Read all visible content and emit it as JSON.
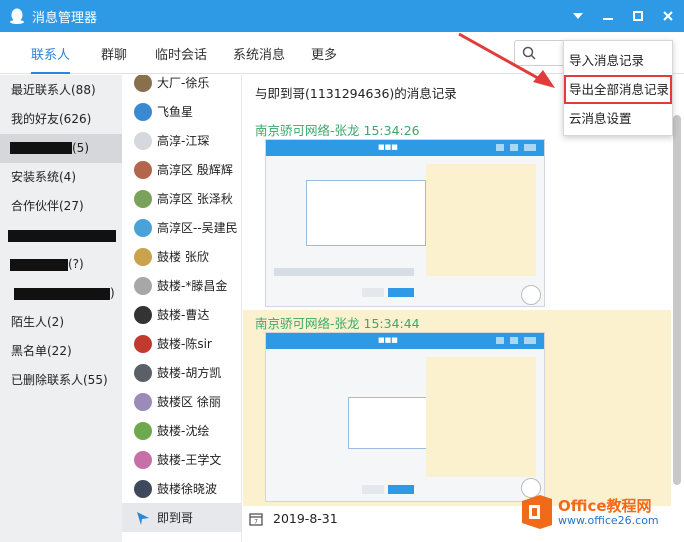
{
  "window": {
    "title": "消息管理器",
    "controls": [
      "chevron-down",
      "minimize",
      "maximize",
      "close"
    ]
  },
  "nav": {
    "tabs": [
      "联系人",
      "群聊",
      "临时会话",
      "系统消息",
      "更多"
    ],
    "active_tab": "联系人",
    "search_placeholder": ""
  },
  "sidebar": {
    "items": [
      "最近联系人(88)",
      "我的好友(626)",
      "",
      "安装系统(4)",
      "合作伙伴(27)",
      "",
      "",
      "",
      "陌生人(2)",
      "黑名单(22)",
      "已删除联系人(55)"
    ],
    "partial_visible": [
      "(5)",
      "(?)",
      ")"
    ],
    "selected_index": 2
  },
  "contacts": {
    "items": [
      "大厂-徐乐",
      "飞鱼星",
      "高淳-江琛",
      "高淳区  殷辉辉",
      "高淳区  张泽秋",
      "高淳区--吴建民",
      "鼓楼 张欣",
      "鼓楼-*滕昌金",
      "鼓楼-曹达",
      "鼓楼-陈sir",
      "鼓楼-胡方凯",
      "鼓楼区  徐丽",
      "鼓楼-沈绘",
      "鼓楼-王学文",
      "鼓楼徐晓波",
      "即到哥"
    ],
    "selected_index": 15
  },
  "main": {
    "header": "与即到哥(1131294636)的消息记录",
    "messages": [
      {
        "sender": "南京骄可网络-张龙",
        "time": "15:34:26",
        "highlighted": false
      },
      {
        "sender": "南京骄可网络-张龙",
        "time": "15:34:44",
        "highlighted": true
      }
    ],
    "date": "2019-8-31"
  },
  "dropdown": {
    "items": [
      "导入消息记录",
      "导出全部消息记录",
      "云消息设置"
    ],
    "highlighted_index": 1
  },
  "brand": {
    "title": "Office教程网",
    "site": "www.office26.com"
  },
  "colors": {
    "titlebar": "#2e9ae6",
    "accent": "#2a86d8",
    "sender": "#3aa86a",
    "highlight": "#fbf1cf",
    "annotation": "#e23b3b",
    "brand": "#f06a1a"
  }
}
